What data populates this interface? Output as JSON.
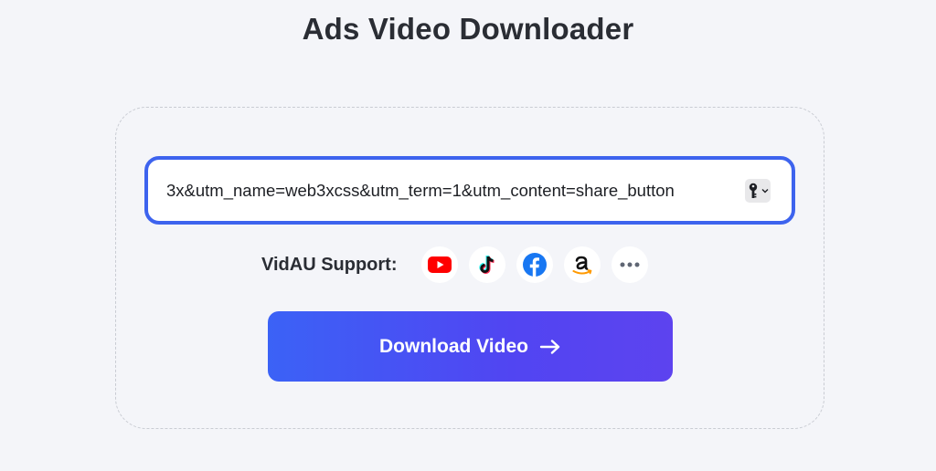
{
  "page": {
    "title": "Ads Video Downloader"
  },
  "url_input": {
    "value": "3x&utm_name=web3xcss&utm_term=1&utm_content=share_button"
  },
  "support": {
    "label": "VidAU Support:",
    "platforms": [
      {
        "name": "YouTube",
        "icon": "youtube-icon"
      },
      {
        "name": "TikTok",
        "icon": "tiktok-icon"
      },
      {
        "name": "Facebook",
        "icon": "facebook-icon"
      },
      {
        "name": "Amazon",
        "icon": "amazon-icon"
      },
      {
        "name": "More",
        "icon": "more-icon"
      }
    ]
  },
  "download_button": {
    "label": "Download Video",
    "icon": "arrow-right-icon"
  },
  "colors": {
    "accent": "#3d63ee",
    "button_gradient_start": "#3b62f6",
    "button_gradient_end": "#5d43ef",
    "youtube": "#ff0000",
    "facebook": "#1877f2",
    "amazon_smile": "#ff9900"
  }
}
